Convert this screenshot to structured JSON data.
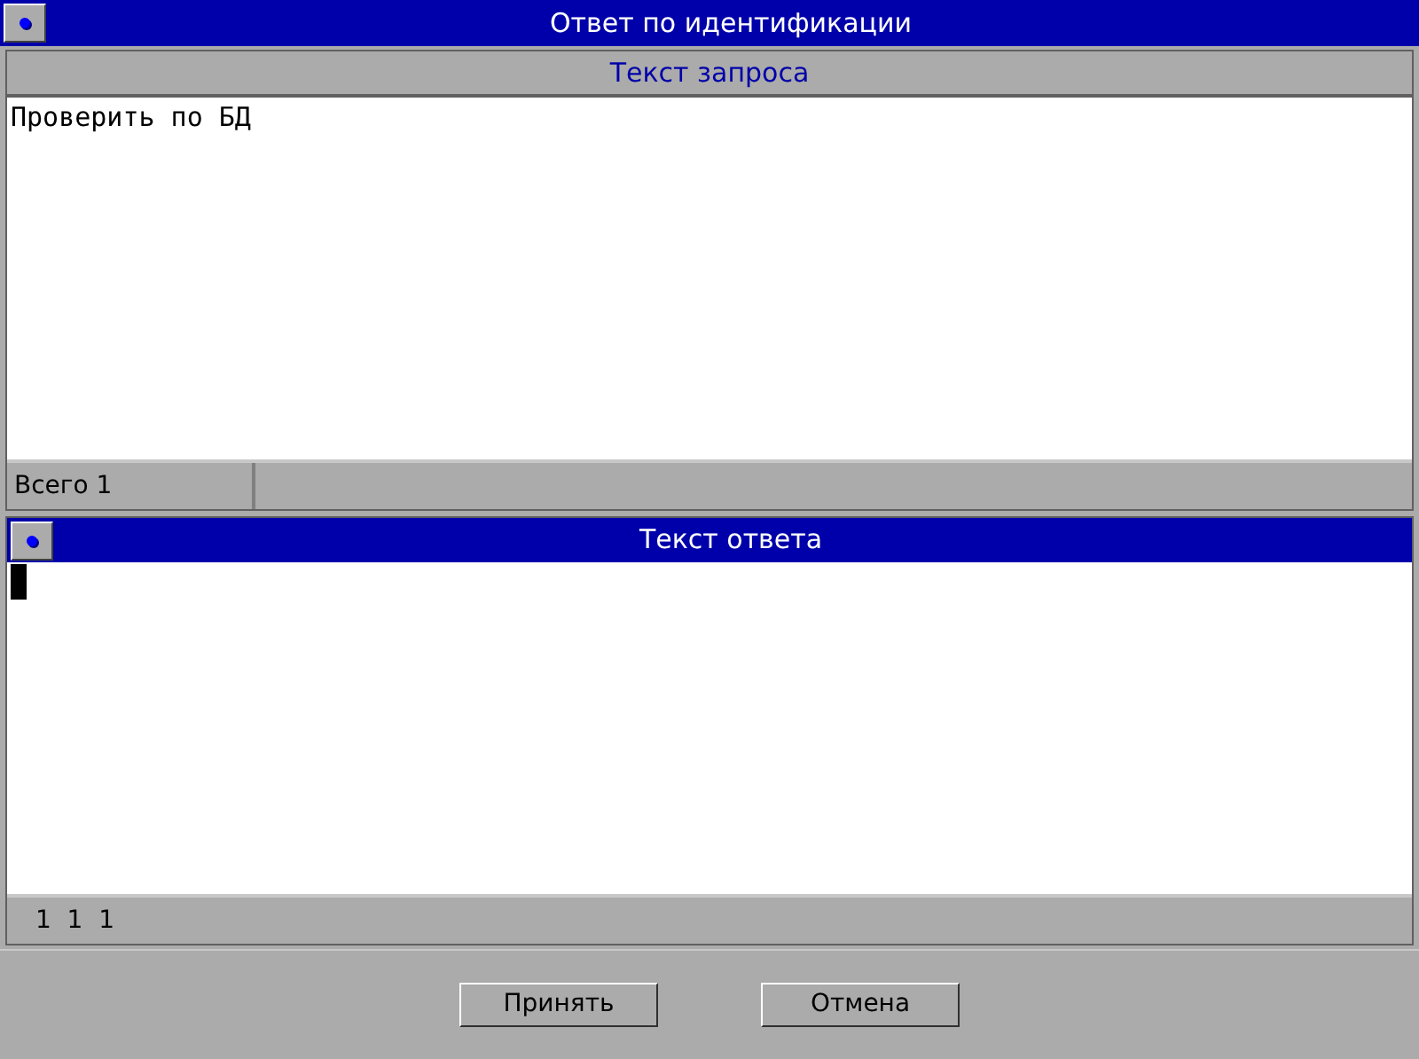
{
  "window": {
    "title": "Ответ по идентификации"
  },
  "request": {
    "header": "Текст запроса",
    "text": "Проверить по БД",
    "status": "Всего 1"
  },
  "response": {
    "title": "Текст ответа",
    "status": "1  1  1"
  },
  "buttons": [
    "Принять",
    "Отмена"
  ]
}
